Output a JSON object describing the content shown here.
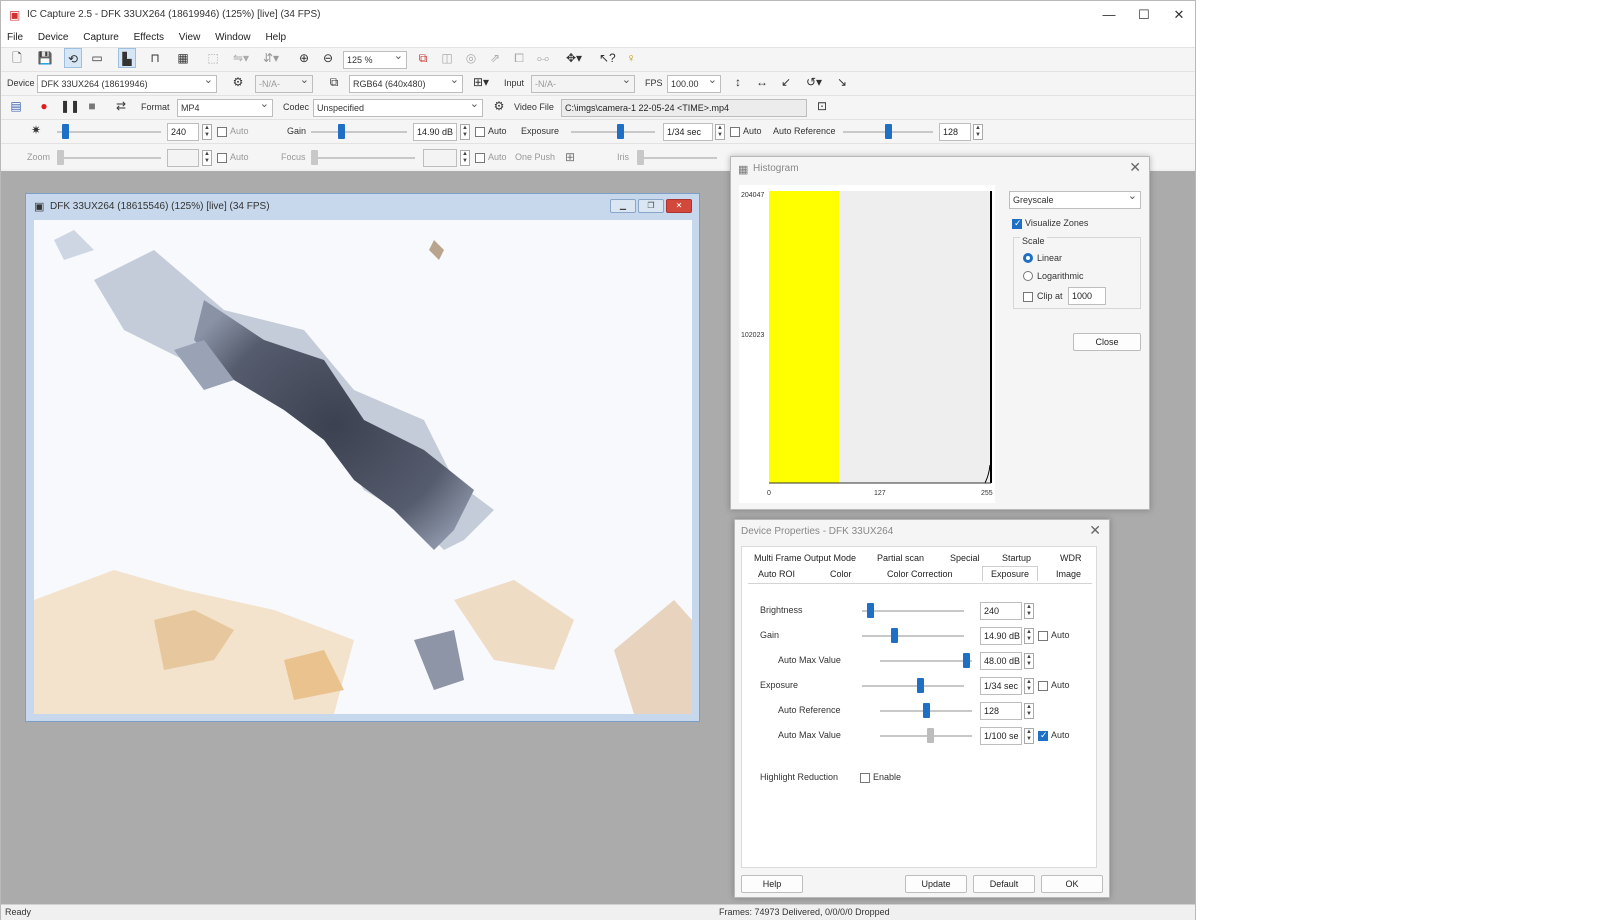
{
  "window": {
    "title": "IC Capture 2.5 - DFK 33UX264 (18619946) (125%) [live] (34 FPS)"
  },
  "menu": [
    "File",
    "Device",
    "Capture",
    "Effects",
    "View",
    "Window",
    "Help"
  ],
  "toolbar": {
    "zoom_value": "125 %"
  },
  "device_bar": {
    "device_label": "Device",
    "device_value": "DFK 33UX264 (18619946)",
    "na_value": "-N/A-",
    "format_value": "RGB64 (640x480)",
    "input_label": "Input",
    "input_value": "-N/A-",
    "fps_label": "FPS",
    "fps_value": "100.00"
  },
  "capture_bar": {
    "format_label": "Format",
    "format_value": "MP4",
    "codec_label": "Codec",
    "codec_value": "Unspecified",
    "video_file_label": "Video File",
    "video_file_value": "C:\\imgs\\camera-1 22-05-24 <TIME>.mp4"
  },
  "props_bar": {
    "brightness_value": "240",
    "brightness_level": 0.05,
    "auto_label": "Auto",
    "gain_label": "Gain",
    "gain_value": "14.90 dB",
    "gain_level": 0.3,
    "exposure_label": "Exposure",
    "exposure_value": "1/34 sec",
    "exposure_level": 0.6,
    "auto_reference_label": "Auto Reference",
    "auto_reference_value": "128",
    "auto_reference_level": 0.5,
    "zoom_label": "Zoom",
    "focus_label": "Focus",
    "one_push_label": "One Push",
    "iris_label": "Iris"
  },
  "video_window": {
    "title": "DFK 33UX264 (18615546) (125%) [live] (34 FPS)"
  },
  "histogram": {
    "title": "Histogram",
    "mode_value": "Greyscale",
    "visualize_zones_label": "Visualize Zones",
    "visualize_zones_checked": true,
    "scale_label": "Scale",
    "linear_label": "Linear",
    "logarithmic_label": "Logarithmic",
    "clip_label": "Clip at",
    "clip_value": "1000",
    "close_label": "Close",
    "y_max_label": "204047",
    "y_mid_label": "102023",
    "x_labels": [
      "0",
      "127",
      "255"
    ],
    "highlight_color": "#ffff00"
  },
  "device_properties": {
    "title": "Device Properties - DFK 33UX264",
    "tabs_row1": [
      "Multi Frame Output Mode",
      "Partial scan",
      "Special",
      "Startup",
      "WDR"
    ],
    "tabs_row2": [
      "Auto ROI",
      "Color",
      "Color Correction",
      "Exposure",
      "Image"
    ],
    "active_tab": "Exposure",
    "rows": [
      {
        "label": "Brightness",
        "value": "240",
        "level": 0.05,
        "indent": false,
        "auto": null
      },
      {
        "label": "Gain",
        "value": "14.90 dB",
        "level": 0.3,
        "indent": false,
        "auto": false
      },
      {
        "label": "Auto Max Value",
        "value": "48.00 dB",
        "level": 0.98,
        "indent": true,
        "auto": null
      },
      {
        "label": "Exposure",
        "value": "1/34 sec",
        "level": 0.58,
        "indent": false,
        "auto": false
      },
      {
        "label": "Auto Reference",
        "value": "128",
        "level": 0.5,
        "indent": true,
        "auto": null
      },
      {
        "label": "Auto Max Value",
        "value": "1/100 se",
        "level": 0.55,
        "indent": true,
        "auto": true
      }
    ],
    "auto_label": "Auto",
    "highlight_label": "Highlight Reduction",
    "enable_label": "Enable",
    "buttons": [
      "Help",
      "Update",
      "Default",
      "OK"
    ]
  },
  "status": {
    "left": "Ready",
    "frames": "Frames: 74973 Delivered, 0/0/0/0 Dropped"
  },
  "colors": {
    "accent": "#1f6fc4",
    "workspace": "#ababab"
  }
}
